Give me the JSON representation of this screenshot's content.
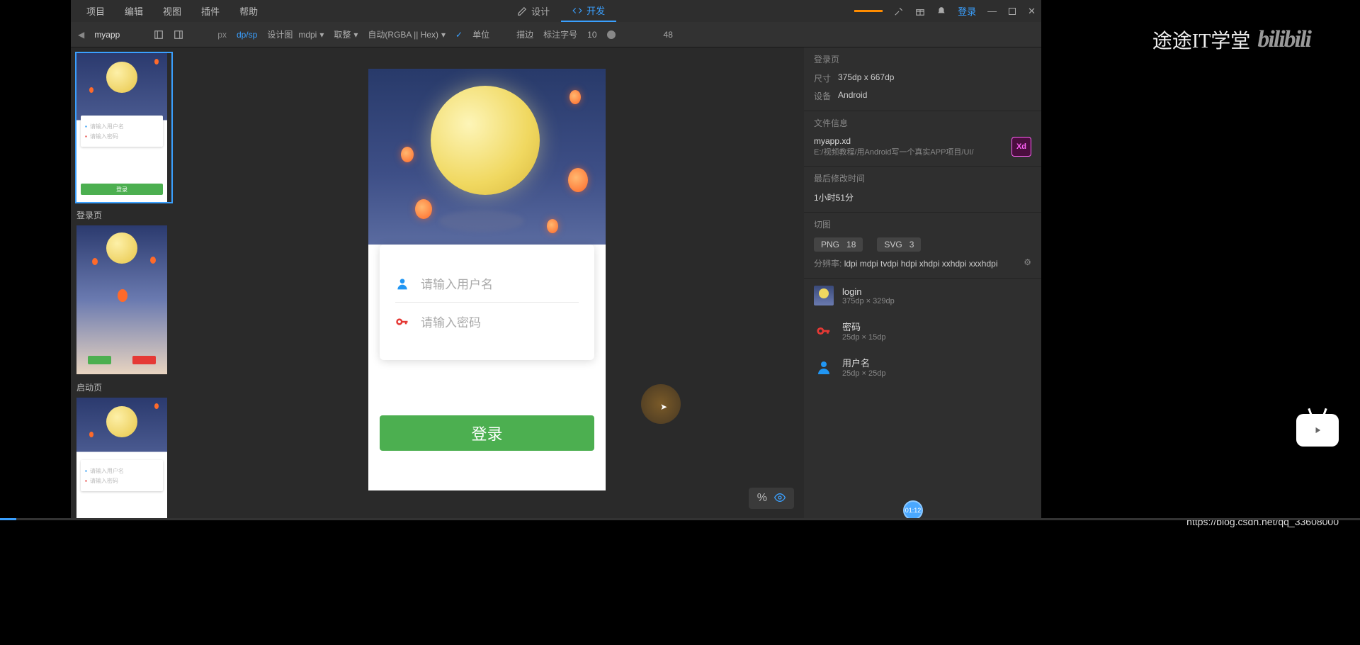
{
  "menubar": {
    "items": [
      "项目",
      "编辑",
      "视图",
      "插件",
      "帮助"
    ],
    "mode_design": "设计",
    "mode_develop": "开发",
    "login_text": "登录"
  },
  "toolbar": {
    "project_name": "myapp",
    "units": {
      "px": "px",
      "dpsp": "dp/sp"
    },
    "design_label": "设计图",
    "density": "mdpi",
    "rounding": "取整",
    "color_format": "自动(RGBA || Hex)",
    "unit_checkbox": "单位",
    "annotation": "描边",
    "annotation_font": "标注字号",
    "annotation_font_value": "10",
    "zoom": "48"
  },
  "artboards": [
    {
      "label": "登录页",
      "selected": true
    },
    {
      "label": "启动页",
      "selected": false
    },
    {
      "label": "",
      "selected": false
    }
  ],
  "canvas": {
    "username_placeholder": "请输入用户名",
    "password_placeholder": "请输入密码",
    "login_button": "登录"
  },
  "inspector": {
    "artboard_name": "登录页",
    "size_label": "尺寸",
    "size_value": "375dp  x  667dp",
    "device_label": "设备",
    "device_value": "Android",
    "file_info_header": "文件信息",
    "filename": "myapp.xd",
    "filepath": "E:/视频教程/用Android写一个真实APP项目/UI/",
    "modified_header": "最后修改时间",
    "modified_value": "1小时51分",
    "slices_header": "切图",
    "png_label": "PNG",
    "png_count": "18",
    "svg_label": "SVG",
    "svg_count": "3",
    "resolution_label": "分辨率:",
    "resolutions": "ldpi mdpi tvdpi hdpi xhdpi xxhdpi xxxhdpi",
    "slices": [
      {
        "name": "login",
        "dim": "375dp × 329dp",
        "color": "#3a4a7a"
      },
      {
        "name": "密码",
        "dim": "25dp × 15dp",
        "color": "#e53935"
      },
      {
        "name": "用户名",
        "dim": "25dp × 25dp",
        "color": "#2196f3"
      }
    ]
  },
  "overlay": {
    "brand": "途途IT学堂",
    "bilibili": "bilibili",
    "watermark": "https://blog.csdn.net/qq_33608000",
    "timebadge": "01:12"
  }
}
